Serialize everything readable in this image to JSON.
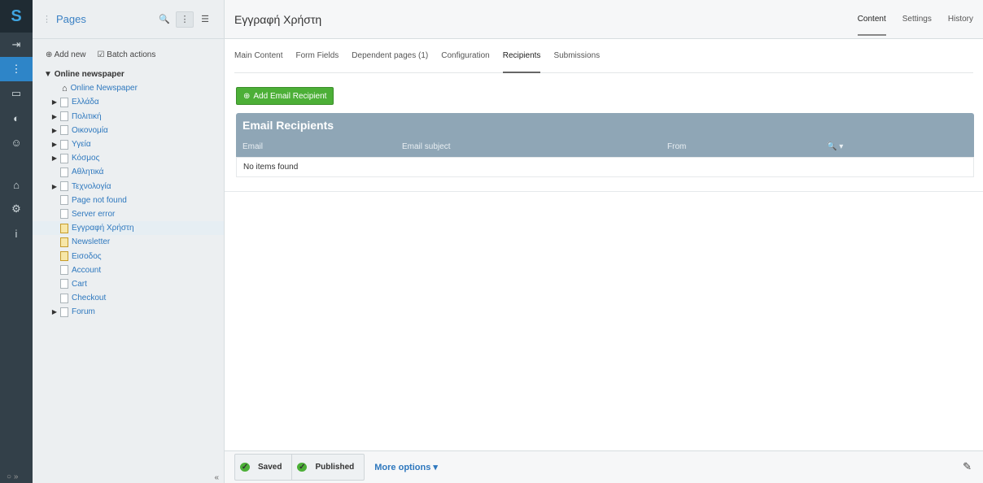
{
  "menu": {
    "logo": "S",
    "items": [
      {
        "icon": "logout-icon",
        "glyph": "⇥"
      },
      {
        "icon": "sitetree-icon",
        "glyph": "⋮"
      },
      {
        "icon": "files-icon",
        "glyph": "▭"
      },
      {
        "icon": "reports-icon",
        "glyph": "◐"
      },
      {
        "icon": "security-icon",
        "glyph": "☺"
      },
      {
        "icon": "shop-icon",
        "glyph": "⌂"
      },
      {
        "icon": "settings-icon",
        "glyph": "⚙"
      },
      {
        "icon": "help-icon",
        "glyph": "i"
      }
    ],
    "bottom": "○ »"
  },
  "tree": {
    "title": "Pages",
    "add_new": "Add new",
    "batch_actions": "Batch actions",
    "root": "Online newspaper",
    "collapse": "«",
    "nodes": [
      {
        "label": "Online Newspaper",
        "expander": "",
        "icon": "home-icon",
        "indent": 1
      },
      {
        "label": "Ελλάδα",
        "expander": "▶",
        "icon": "page-icon",
        "indent": 1
      },
      {
        "label": "Πολιτική",
        "expander": "▶",
        "icon": "page-icon",
        "indent": 1
      },
      {
        "label": "Οικονομία",
        "expander": "▶",
        "icon": "page-icon",
        "indent": 1
      },
      {
        "label": "Υγεία",
        "expander": "▶",
        "icon": "page-icon",
        "indent": 1
      },
      {
        "label": "Κόσμος",
        "expander": "▶",
        "icon": "page-icon",
        "indent": 1
      },
      {
        "label": "Αθλητικά",
        "expander": "",
        "icon": "page-icon",
        "indent": 1
      },
      {
        "label": "Τεχνολογία",
        "expander": "▶",
        "icon": "page-icon",
        "indent": 1
      },
      {
        "label": "Page not found",
        "expander": "",
        "icon": "errorpage-icon",
        "indent": 1
      },
      {
        "label": "Server error",
        "expander": "",
        "icon": "errorpage-icon",
        "indent": 1
      },
      {
        "label": "Εγγραφή Χρήστη",
        "expander": "",
        "icon": "userform-icon",
        "indent": 1,
        "selected": true
      },
      {
        "label": "Newsletter",
        "expander": "",
        "icon": "userform-icon",
        "indent": 1
      },
      {
        "label": "Εισοδος",
        "expander": "",
        "icon": "userform-icon",
        "indent": 1
      },
      {
        "label": "Account",
        "expander": "",
        "icon": "page-icon",
        "indent": 1
      },
      {
        "label": "Cart",
        "expander": "",
        "icon": "page-icon",
        "indent": 1
      },
      {
        "label": "Checkout",
        "expander": "",
        "icon": "page-icon",
        "indent": 1
      },
      {
        "label": "Forum",
        "expander": "▶",
        "icon": "page-icon",
        "indent": 1
      }
    ]
  },
  "header": {
    "title": "Εγγραφή Χρήστη",
    "tabs": [
      "Content",
      "Settings",
      "History"
    ]
  },
  "subtabs": [
    "Main Content",
    "Form Fields",
    "Dependent pages (1)",
    "Configuration",
    "Recipients",
    "Submissions"
  ],
  "add_button": "Add Email Recipient",
  "grid": {
    "title": "Email Recipients",
    "columns": [
      "Email",
      "Email subject",
      "From"
    ],
    "empty": "No items found"
  },
  "footer": {
    "saved": "Saved",
    "published": "Published",
    "more_options": "More options"
  }
}
